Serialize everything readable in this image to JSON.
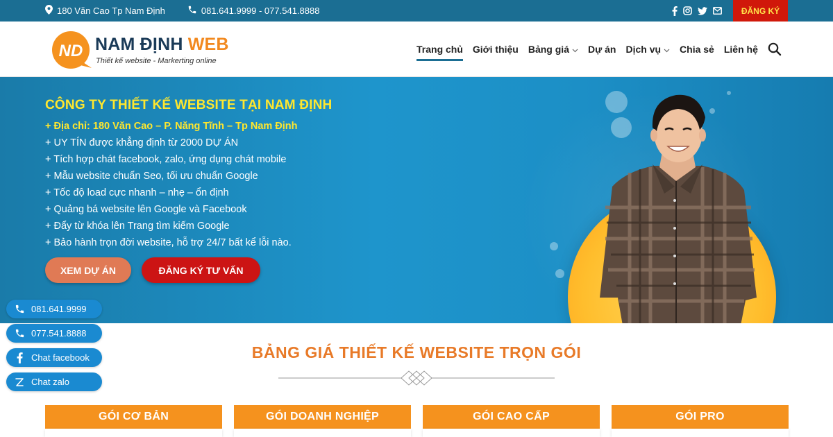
{
  "topbar": {
    "address": "180 Văn Cao Tp Nam Định",
    "phones": "081.641.9999 - 077.541.8888",
    "register_label": "ĐĂNG KÝ",
    "social_icons": [
      "facebook-icon",
      "instagram-icon",
      "twitter-icon",
      "email-icon"
    ]
  },
  "header": {
    "logo_badge": "ND",
    "brand_part1": "NAM ĐỊNH",
    "brand_part2": "WEB",
    "tagline": "Thiết kế website - Markerting online",
    "nav": [
      {
        "label": "Trang chủ",
        "active": true
      },
      {
        "label": "Giới thiệu"
      },
      {
        "label": "Bảng giá",
        "dropdown": true
      },
      {
        "label": "Dự án"
      },
      {
        "label": "Dịch vụ",
        "dropdown": true
      },
      {
        "label": "Chia sẻ"
      },
      {
        "label": "Liên hệ"
      }
    ]
  },
  "hero": {
    "title": "CÔNG TY THIẾT KẾ WEBSITE TẠI NAM ĐỊNH",
    "lines": [
      "+ Địa chỉ: 180 Văn Cao – P. Năng Tĩnh – Tp Nam Định",
      "+ UY TÍN được khẳng định từ 2000 DỰ ÁN",
      "+ Tích hợp chát facebook, zalo, ứng dụng chát mobile",
      "+ Mẫu website chuẩn Seo, tối ưu chuẩn Google",
      "+ Tốc độ load cực nhanh – nhẹ – ổn định",
      "+ Quảng bá website lên Google và Facebook",
      "+ Đẩy từ khóa lên Trang tìm kiếm Google",
      "+ Bảo hành trọn đời website, hỗ trợ 24/7 bất kể lỗi nào."
    ],
    "button_projects": "XEM DỰ ÁN",
    "button_consult": "ĐĂNG KÝ TƯ VẤN"
  },
  "floating": [
    {
      "icon": "phone-icon",
      "label": "081.641.9999"
    },
    {
      "icon": "phone-icon",
      "label": "077.541.8888"
    },
    {
      "icon": "facebook-icon",
      "label": "Chat facebook"
    },
    {
      "icon": "zalo-icon",
      "label": "Chat zalo"
    }
  ],
  "pricing": {
    "title": "BẢNG GIÁ THIẾT KẾ WEBSITE TRỌN GÓI",
    "plans": [
      "GÓI CƠ BẢN",
      "GÓI DOANH NGHIỆP",
      "GÓI CAO CẤP",
      "GÓI PRO"
    ]
  },
  "colors": {
    "topbar": "#1b6e93",
    "accent_orange": "#f5921e",
    "title_orange": "#e87a28",
    "register_red": "#d0180a",
    "hero_yellow": "#ffe72e",
    "float_blue": "#1a8ad1"
  }
}
